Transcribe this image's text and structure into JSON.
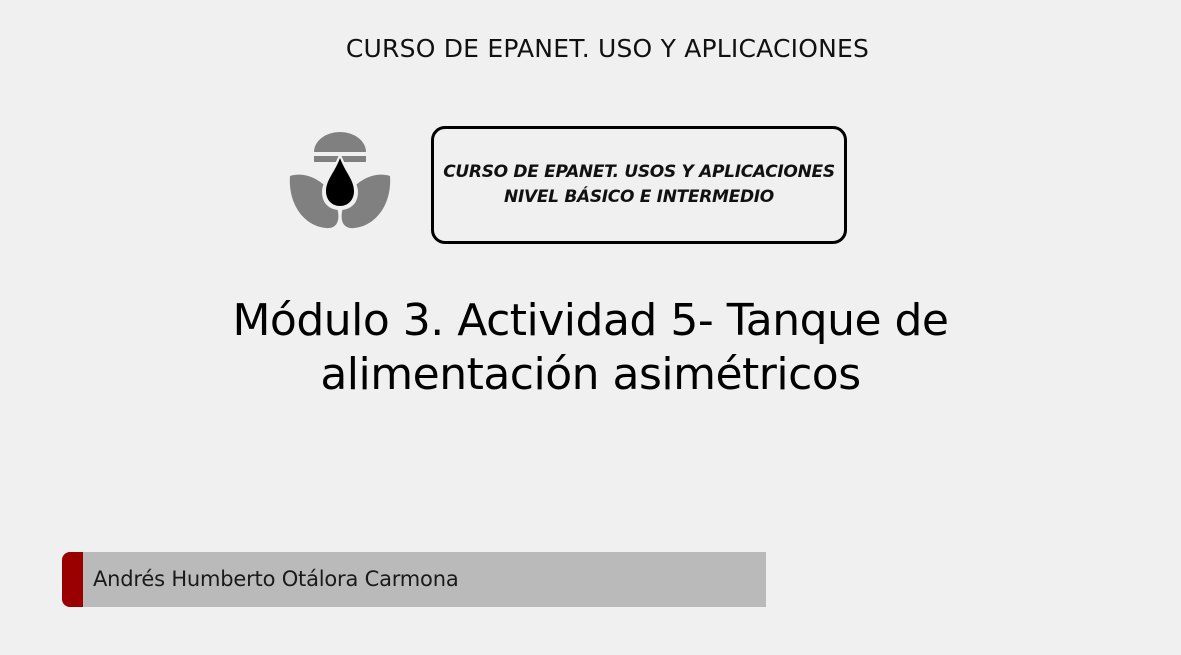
{
  "slide": {
    "header_title": "CURSO DE EPANET. USO Y APLICACIONES",
    "banner": {
      "line1": "CURSO DE EPANET. USOS Y APLICACIONES",
      "line2": "NIVEL BÁSICO E INTERMEDIO"
    },
    "main_title": {
      "line1": "Módulo 3. Actividad 5- Tanque de",
      "line2": "alimentación asimétricos"
    },
    "author": "Andrés Humberto Otálora Carmona",
    "logo_icon": "water-drop-leaves-logo-icon",
    "colors": {
      "background": "#f0f0f0",
      "accent": "#9a0000",
      "author_bar": "#bababa"
    }
  }
}
